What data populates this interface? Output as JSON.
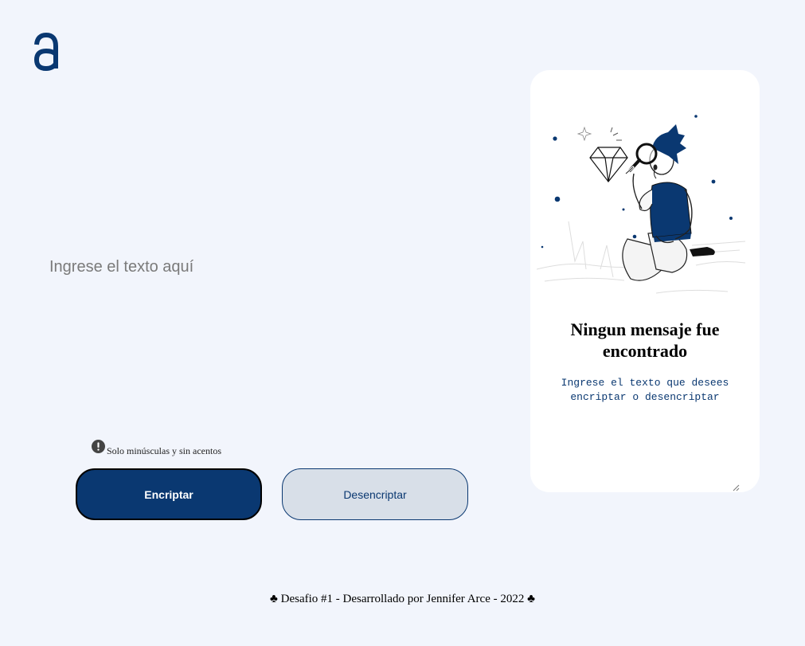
{
  "brand": {
    "logo_icon": "alura-logo-icon",
    "color": "#0a3871"
  },
  "input": {
    "placeholder": "Ingrese el texto aquí",
    "value": ""
  },
  "hint": {
    "icon": "exclamation-circle-icon",
    "text": "Solo minúsculas y sin acentos"
  },
  "buttons": {
    "encrypt_label": "Encriptar",
    "decrypt_label": "Desencriptar"
  },
  "output_panel": {
    "illustration": "person-with-magnifying-glass-illustration",
    "title": "Ningun mensaje fue encontrado",
    "subtitle": "Ingrese el texto que desees encriptar o desencriptar"
  },
  "footer": {
    "text": "♣ Desafio #1 - Desarrollado por Jennifer Arce - 2022 ♣"
  },
  "colors": {
    "background": "#f2f5fc",
    "primary": "#0a3871",
    "secondary": "#d8dfe8",
    "panel": "#ffffff"
  }
}
